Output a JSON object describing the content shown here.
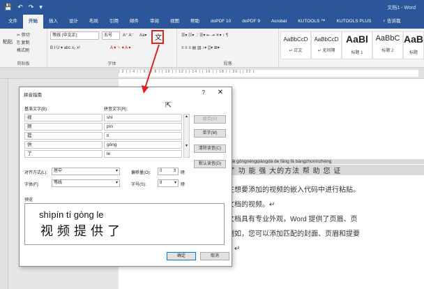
{
  "titlebar": {
    "quick_access": [
      "💾",
      "↶",
      "↷",
      "▾"
    ],
    "doc_title": "文档1 - Word"
  },
  "tabs": [
    "文件",
    "开始",
    "插入",
    "设计",
    "布局",
    "引用",
    "邮件",
    "审阅",
    "视图",
    "帮助",
    "doPDF 10",
    "doPDF 9",
    "Acrobat",
    "KUTOOLS ™",
    "KUTOOLS PLUS",
    "♀ 告诉我"
  ],
  "ribbon": {
    "clipboard": {
      "cut": "✂ 剪切",
      "copy": "⎘ 复制",
      "paste": "粘贴",
      "format_painter": "格式刷",
      "label": "剪贴板"
    },
    "font": {
      "name": "等线 (中文正)",
      "size": "五号",
      "row2": "B  I  U ▾ abc  x₂  x²",
      "grow": "A⁺ A⁻",
      "case": "Aa▾",
      "label": "字体"
    },
    "phonetic": "文",
    "paragraph": {
      "label": "段落"
    },
    "styles": [
      {
        "sample": "AaBbCcD",
        "name": "↵ 正文"
      },
      {
        "sample": "AaBbCcD",
        "name": "↵ 无间隔"
      },
      {
        "sample": "AaBl",
        "name": "标题 1"
      },
      {
        "sample": "AaBbC",
        "name": "标题 2"
      },
      {
        "sample": "AaBl",
        "name": "标题"
      }
    ]
  },
  "ruler_marks": "| 2 |  | 4 |  | 6 |  | 8 |  | 10 |  | 12 |  | 14 |  | 16 |  | 18 |  | 20 |  | 22 |",
  "dialog": {
    "title": "拼音指南",
    "help": "?",
    "close": "✕",
    "base_text_label": "基准文字(B):",
    "ruby_text_label": "拼音文字(R):",
    "rows": [
      {
        "base": "视",
        "ruby": "shì"
      },
      {
        "base": "频",
        "ruby": "pín"
      },
      {
        "base": "提",
        "ruby": "tí"
      },
      {
        "base": "供",
        "ruby": "gōng"
      },
      {
        "base": "了",
        "ruby": "le"
      }
    ],
    "buttons": {
      "combine": "组合(G)",
      "single": "单字(M)",
      "clear": "清除读音(C)",
      "default": "默认读音(D)",
      "ok": "确定",
      "cancel": "取消"
    },
    "alignment_label": "对齐方式(L):",
    "alignment_value": "居中",
    "offset_label": "偏移量(O):",
    "offset_value": "0",
    "offset_unit": "磅",
    "font_label": "字体(F):",
    "font_value": "等线",
    "size_label": "字号(S):",
    "size_value": "9",
    "size_unit": "磅",
    "preview_label": "预览",
    "preview_pinyin": "shìpín tí gòng le",
    "preview_hanzi": "视频提供了"
  },
  "document": {
    "ruby_line": "gōng le gōngnéngqiángdà de fāng fǎ bāngzhùnínzhèng",
    "line1": "供了 功 能 强 大的方法 帮 助 您 证",
    "line2": "以在想要添加的视频的嵌入代码中进行粘贴。",
    "line3": "的文档的视频。↵",
    "line4": "的文档具有专业外观，Word 提供了页眉、页",
    "line5": "，例如，您可以添加匹配的封面、页眉和提要",
    "line6": "素。↵"
  },
  "colors": {
    "accent": "#2b579a",
    "annotation": "#e02020"
  }
}
